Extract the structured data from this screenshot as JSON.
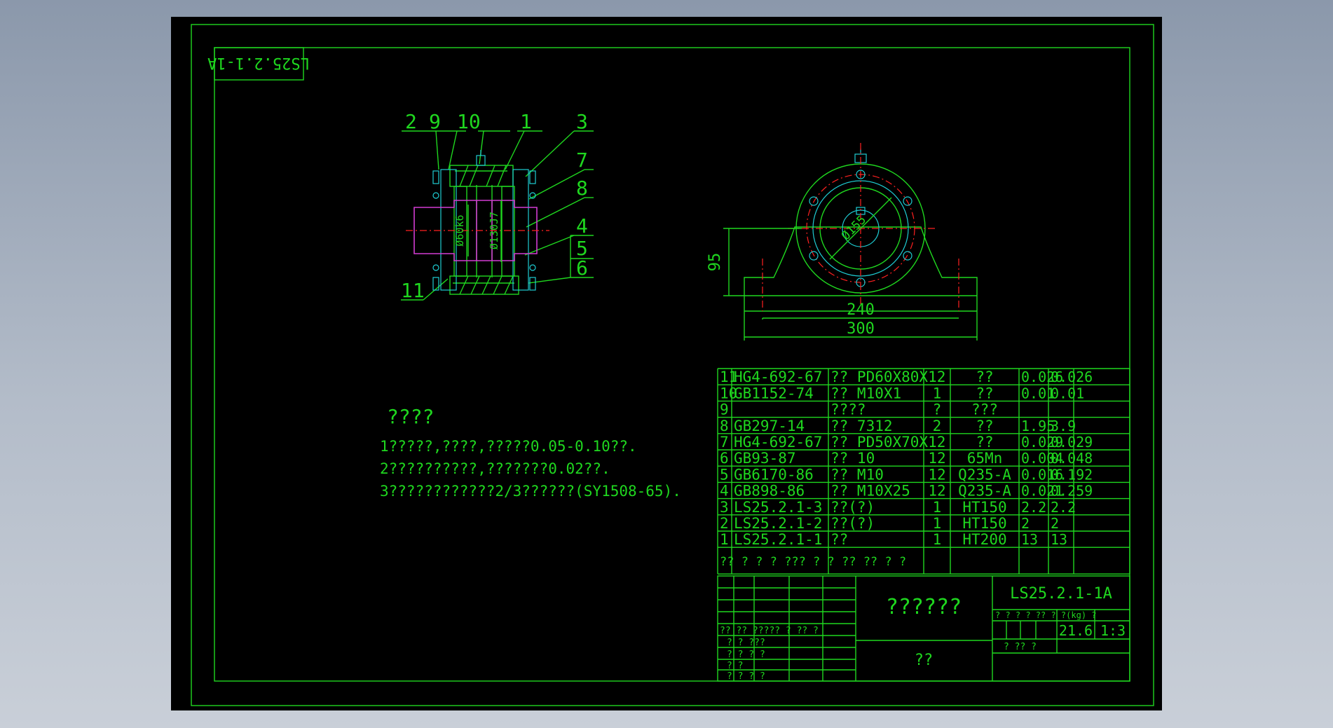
{
  "drawing_number": "LS25.2.1-1A",
  "drawing_number_rotated": "LS25.2.1-1A",
  "balloons": [
    "2",
    "9",
    "10",
    "1",
    "3",
    "7",
    "8",
    "4",
    "5",
    "6",
    "11"
  ],
  "section_labels": {
    "shaft_dia": "Ø60k6",
    "bore_dia": "Ø130J7"
  },
  "end_view": {
    "bolt_circle": "Ø155",
    "height": "95",
    "bolt_span": "240",
    "base_length": "300"
  },
  "notes": {
    "title": "????",
    "lines": [
      "1?????,????,?????0.05-0.10??.",
      "2??????????,???????0.02??.",
      "3????????????2/3??????(SY1508-65)."
    ]
  },
  "bom": {
    "rows": [
      {
        "no": "11",
        "code": "HG4-692-67",
        "name": "?? PD60X80X12",
        "qty": "",
        "material": "??",
        "unit": "0.026",
        "total": "0.026"
      },
      {
        "no": "10",
        "code": "GB1152-74",
        "name": "?? M10X1",
        "qty": "1",
        "material": "??",
        "unit": "0.01",
        "total": "0.01"
      },
      {
        "no": "9",
        "code": "",
        "name": "????",
        "qty": "?",
        "material": "???",
        "unit": "",
        "total": ""
      },
      {
        "no": "8",
        "code": "GB297-14",
        "name": "?? 7312",
        "qty": "2",
        "material": "??",
        "unit": "1.95",
        "total": "3.9"
      },
      {
        "no": "7",
        "code": "HG4-692-67",
        "name": "?? PD50X70X12",
        "qty": "",
        "material": "??",
        "unit": "0.029",
        "total": "0.029"
      },
      {
        "no": "6",
        "code": "GB93-87",
        "name": "?? 10",
        "qty": "12",
        "material": "65Mn",
        "unit": "0.004",
        "total": "0.048"
      },
      {
        "no": "5",
        "code": "GB6170-86",
        "name": "?? M10",
        "qty": "12",
        "material": "Q235-A",
        "unit": "0.016",
        "total": "0.192"
      },
      {
        "no": "4",
        "code": "GB898-86",
        "name": "?? M10X25",
        "qty": "12",
        "material": "Q235-A",
        "unit": "0.021",
        "total": "0.259"
      },
      {
        "no": "3",
        "code": "LS25.2.1-3",
        "name": "??(?)",
        "qty": "1",
        "material": "HT150",
        "unit": "2.2",
        "total": "2.2"
      },
      {
        "no": "2",
        "code": "LS25.2.1-2",
        "name": "??(?)",
        "qty": "1",
        "material": "HT150",
        "unit": "2",
        "total": "2"
      },
      {
        "no": "1",
        "code": "LS25.2.1-1",
        "name": "??",
        "qty": "1",
        "material": "HT200",
        "unit": "13",
        "total": "13"
      }
    ],
    "header": [
      "??",
      "?",
      "?",
      "?",
      "???",
      "?",
      "?",
      "??",
      "??",
      "?",
      "?"
    ]
  },
  "title_block": {
    "drawing_title": "??????",
    "unit": "??",
    "number": "LS25.2.1-1A",
    "mass_scale_head": "? ? ? ? ??  ? ?(kg) ?",
    "mass": "21.6",
    "scale": "1:3",
    "sheet_row": "?            ??          ?",
    "sign_head": "?? ??  ????? ?  ?? ?",
    "sign_rows": [
      "? ?        ???",
      "? ?        ? ?",
      "? ?",
      "? ?        ? ?"
    ]
  },
  "colors": {
    "line": "#1fd71f",
    "cyan": "#1ecdd3",
    "center": "#ff2020",
    "shaft": "#d23cd2"
  }
}
